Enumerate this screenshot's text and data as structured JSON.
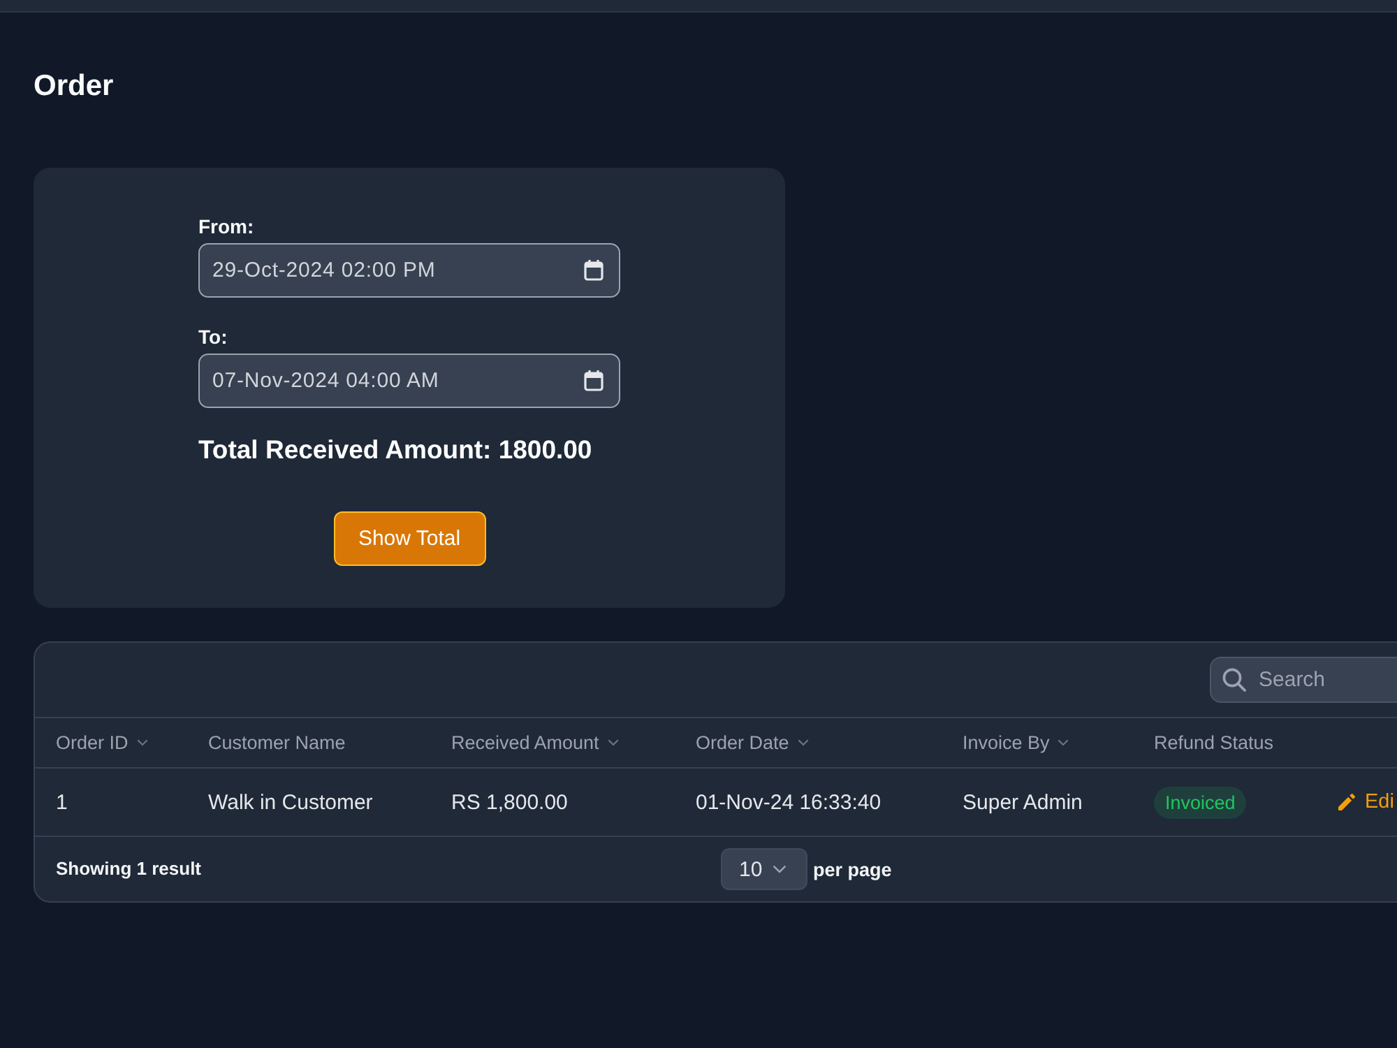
{
  "page": {
    "title": "Order"
  },
  "filter": {
    "from": {
      "label": "From:",
      "value": "29-Oct-2024 02:00 PM"
    },
    "to": {
      "label": "To:",
      "value": "07-Nov-2024 04:00 AM"
    },
    "total": "Total Received Amount: 1800.00",
    "button": "Show Total"
  },
  "table": {
    "search": {
      "placeholder": "Search"
    },
    "columns": [
      {
        "label": "Order ID",
        "sortable": true
      },
      {
        "label": "Customer Name",
        "sortable": false
      },
      {
        "label": "Received Amount",
        "sortable": true
      },
      {
        "label": "Order Date",
        "sortable": true
      },
      {
        "label": "Invoice By",
        "sortable": true
      },
      {
        "label": "Refund Status",
        "sortable": false
      }
    ],
    "rows": [
      {
        "cells": [
          "1",
          "Walk in Customer",
          "RS 1,800.00",
          "01-Nov-24 16:33:40",
          "Super Admin"
        ],
        "status": {
          "label": "Invoiced",
          "color": "#22c55e"
        },
        "action": "Edi"
      }
    ],
    "footer": {
      "summary": "Showing 1 result",
      "page_size": "10",
      "page_size_suffix": "per page"
    }
  }
}
